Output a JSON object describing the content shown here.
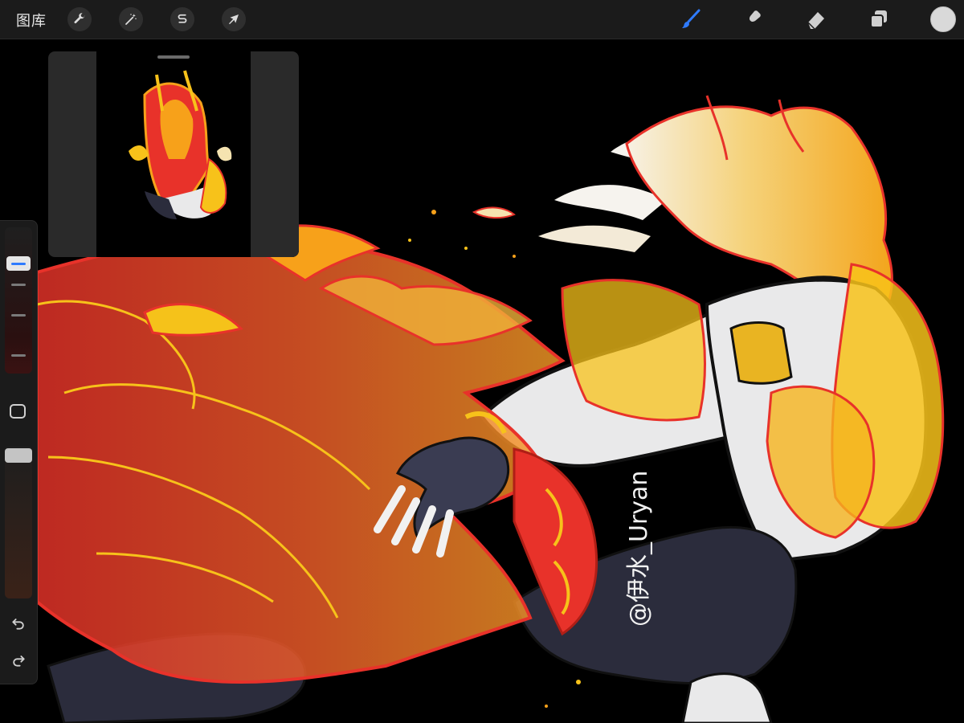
{
  "topbar": {
    "gallery_label": "图库",
    "left_tools": [
      {
        "name": "actions",
        "icon": "wrench-icon"
      },
      {
        "name": "adjustments",
        "icon": "magic-wand-icon"
      },
      {
        "name": "selection",
        "icon": "selection-s-icon"
      },
      {
        "name": "transform",
        "icon": "arrow-cursor-icon"
      }
    ],
    "right_tools": [
      {
        "name": "brush",
        "icon": "brush-icon",
        "active": true
      },
      {
        "name": "smudge",
        "icon": "smudge-icon"
      },
      {
        "name": "eraser",
        "icon": "eraser-icon"
      },
      {
        "name": "layers",
        "icon": "layers-icon"
      }
    ],
    "current_color": "#d9d9d9",
    "active_color": "#2f7bff"
  },
  "reference_window": {
    "icon": "reference-thumbnail"
  },
  "sidebar": {
    "brush_size_fraction": 0.78,
    "brush_opacity_fraction": 0.98,
    "modify_icon": "square-icon",
    "undo_icon": "undo-icon",
    "redo_icon": "redo-icon"
  },
  "artwork": {
    "watermark": "@伊水_Uryan",
    "palette": {
      "flame_red": "#e8322a",
      "flame_orange": "#f08a1e",
      "flame_yellow": "#f7c21a",
      "pale_gold": "#f5e3b0",
      "cloth_white": "#e9e9ea",
      "dark_navy": "#2b2c3c"
    }
  }
}
